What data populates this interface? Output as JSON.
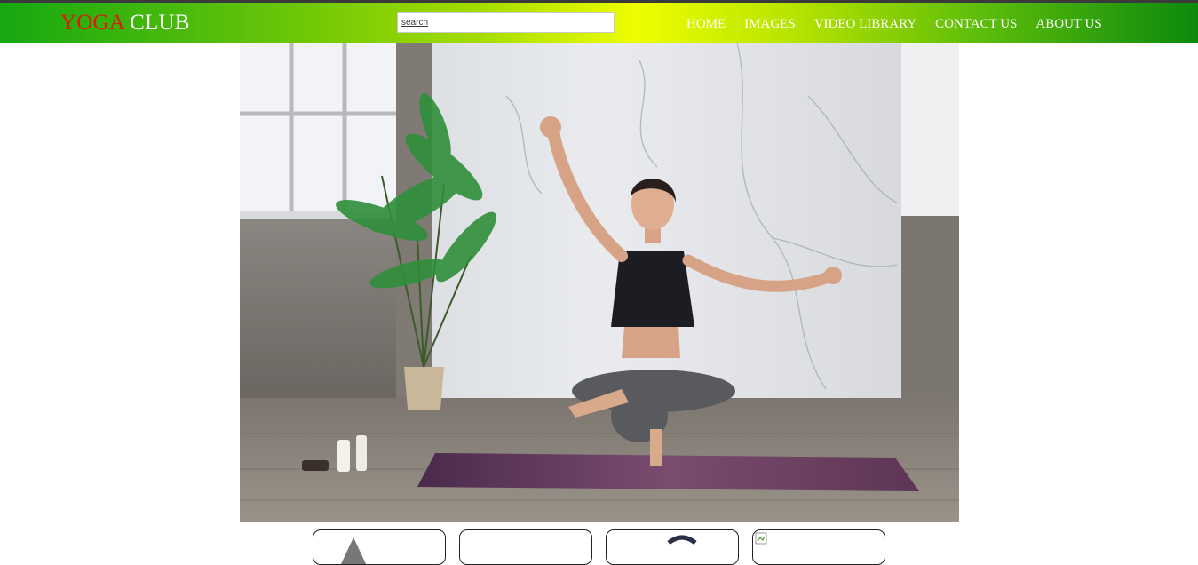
{
  "header": {
    "logo_part1": "YOGA",
    "logo_part2": "CLUB",
    "logo_color_1": "#e01a0a",
    "logo_color_2": "#ffffff",
    "gradient_colors": [
      "#15a810",
      "#eefe00",
      "#0d8a0d"
    ]
  },
  "search": {
    "placeholder": "search",
    "value": ""
  },
  "nav": {
    "items": [
      {
        "label": "HOME"
      },
      {
        "label": "IMAGES"
      },
      {
        "label": "VIDEO LIBRARY"
      },
      {
        "label": "CONTACT US"
      },
      {
        "label": "ABOUT US"
      }
    ]
  },
  "hero": {
    "icon": "yoga-pose-photo"
  },
  "thumbnails": [
    {
      "icon": "thumbnail-image"
    },
    {
      "icon": "thumbnail-image"
    },
    {
      "icon": "thumbnail-image"
    },
    {
      "icon": "broken-image-icon"
    }
  ]
}
